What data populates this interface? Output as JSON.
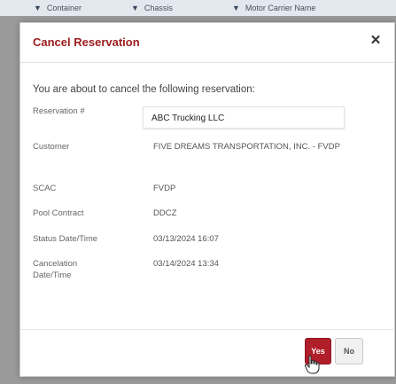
{
  "background_table": {
    "columns": [
      {
        "icon": "filter-icon",
        "label": "Container"
      },
      {
        "icon": "filter-icon",
        "label": "Chassis"
      },
      {
        "icon": "filter-icon",
        "label": "Motor Carrier Name"
      }
    ]
  },
  "modal": {
    "title": "Cancel Reservation",
    "close_label": "✕",
    "intro": "You are about to cancel the following reservation:",
    "details": [
      {
        "label": "Reservation #",
        "value": ""
      },
      {
        "label": "Customer",
        "value": "FIVE DREAMS TRANSPORTATION, INC. - FVDP"
      },
      {
        "label": "SCAC",
        "value": "FVDP"
      },
      {
        "label": "Pool Contract",
        "value": "DDCZ"
      },
      {
        "label": "Status Date/Time",
        "value": "03/13/2024 16:07"
      },
      {
        "label": "Cancelation Date/Time",
        "value": "03/14/2024 13:34"
      }
    ],
    "tooltip": "ABC Trucking LLC",
    "yes_label": "Yes",
    "no_label": "No"
  },
  "colors": {
    "title": "#9c1d1d",
    "yes_button": "#b01e2a"
  }
}
